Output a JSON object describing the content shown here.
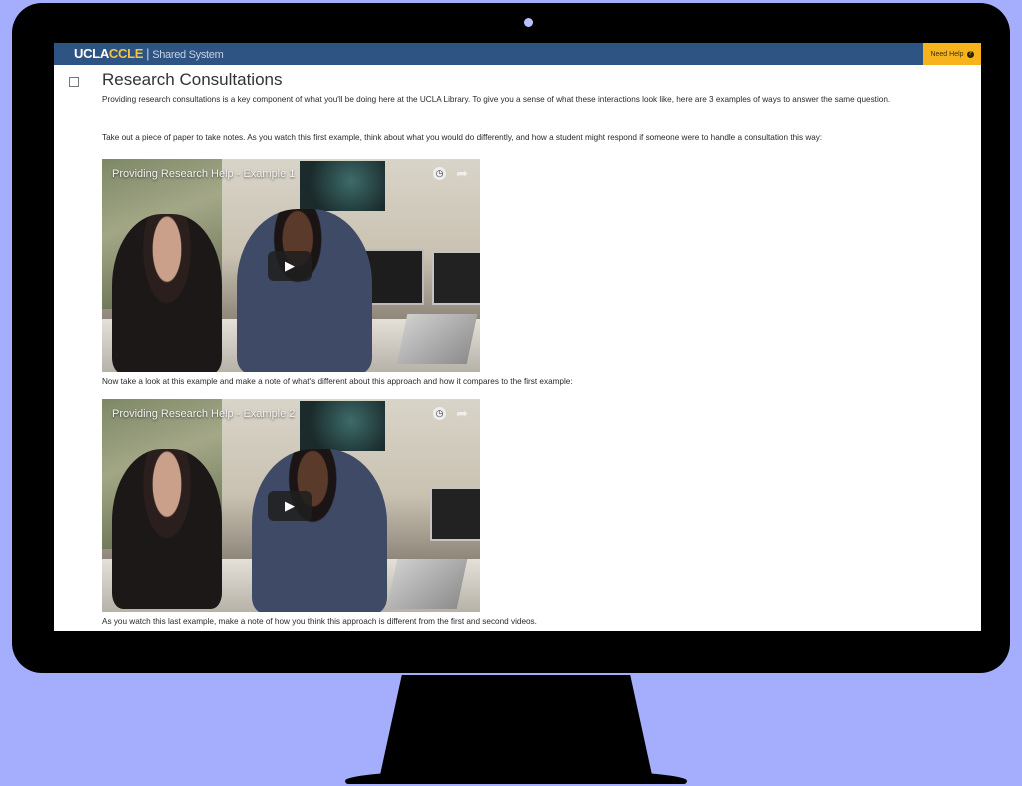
{
  "app": {
    "brand_ucla": "UCLA",
    "brand_ccle": "CCLE",
    "brand_separator": "|",
    "brand_subtitle": "Shared System",
    "help_label": "Need Help",
    "help_icon_glyph": "?"
  },
  "page": {
    "title": "Research Consultations",
    "intro": "Providing research consultations is a key component of what you'll be doing here at the UCLA Library. To give you a sense of what these interactions look like, here are 3 examples of ways to answer the same question.",
    "instruction_1": "Take out a piece of paper to take notes. As you watch this first example, think about what you would do differently, and how a student might respond if someone were to handle a consultation this way:",
    "instruction_2": "Now take a look at this example and make a note of what's different about this approach and how it compares to the first example:",
    "instruction_3": "As you watch this last example, make a note of how you think this approach is different from the first and second videos."
  },
  "videos": [
    {
      "title": "Providing Research Help - Example 1"
    },
    {
      "title": "Providing Research Help - Example 2"
    }
  ],
  "icons": {
    "play": "play-icon",
    "watch_later": "clock-icon",
    "share": "share-icon",
    "checkbox": "checkbox-icon"
  },
  "colors": {
    "page_background": "#a4aefc",
    "topbar": "#2e5483",
    "brand_accent": "#f5c342",
    "help_button": "#f6b31c"
  }
}
